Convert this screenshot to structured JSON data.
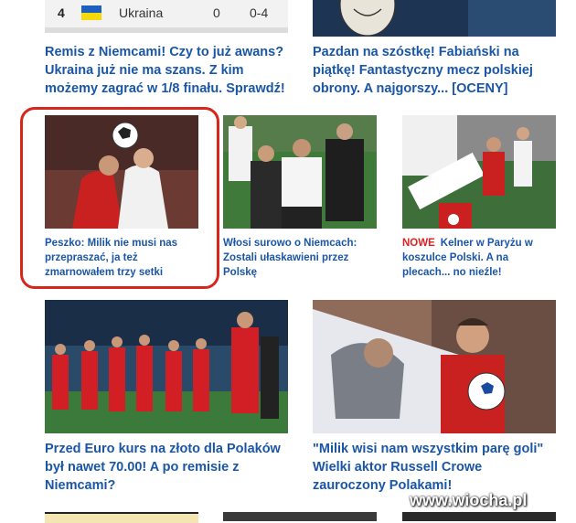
{
  "standings_row": {
    "rank": "4",
    "team": "Ukraina",
    "points": "0",
    "goals": "0-4"
  },
  "top_articles": [
    {
      "title": "Remis z Niemcami! Czy to już awans? Ukraina już nie ma szans. Z kim możemy zagrać w 1/8 finału. Sprawdź!"
    },
    {
      "title": "Pazdan na szóstkę! Fabiański na piątkę! Fantastyczny mecz polskiej obrony. A najgorszy... [OCENY]"
    }
  ],
  "mid_articles": [
    {
      "title": "Peszko: Milik nie musi nas przepraszać, ja też zmarnowałem trzy setki",
      "highlighted": true
    },
    {
      "title": "Włosi surowo o Niemcach: Zostali ułaskawieni przez Polskę"
    },
    {
      "badge": "NOWE",
      "title": "Kelner w Paryżu w koszulce Polski. A na plecach... no nieźle!"
    }
  ],
  "bottom_articles": [
    {
      "title": "Przed Euro kurs na złoto dla Polaków był nawet 70.00! A po remisie z Niemcami?"
    },
    {
      "title": "\"Milik wisi nam wszystkim parę goli\" Wielki aktor Russell Crowe zauroczony Polakami!"
    }
  ],
  "watermark": "www.wiocha.pl",
  "colors": {
    "headline": "#1a56a8",
    "highlight_border": "#d9261c",
    "badge": "#e02020"
  }
}
